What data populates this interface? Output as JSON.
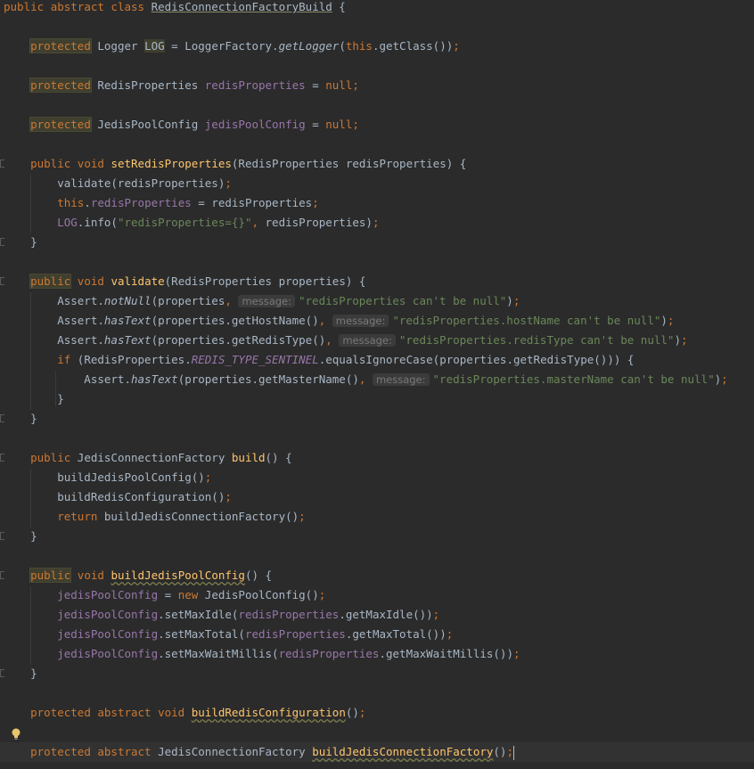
{
  "editor": {
    "language": "Java",
    "theme": "Darcula",
    "colors": {
      "background": "#2b2b2b",
      "keyword": "#cc7832",
      "field": "#9876aa",
      "method": "#ffc66d",
      "string": "#6a8759",
      "text": "#a9b7c6",
      "hint": "#787878"
    },
    "lines": [
      {
        "tokens": [
          [
            "kw",
            "public "
          ],
          [
            "kw",
            "abstract "
          ],
          [
            "kw",
            "class "
          ],
          [
            "cls-ul",
            "RedisConnectionFactoryBuild"
          ],
          [
            "plain",
            " {"
          ]
        ]
      },
      {
        "tokens": []
      },
      {
        "tokens": [
          [
            "plain",
            "    "
          ],
          [
            "kw-hl",
            "protected"
          ],
          [
            "plain",
            " Logger "
          ],
          [
            "field-hl",
            "LOG"
          ],
          [
            "plain",
            " = LoggerFactory."
          ],
          [
            "static-call",
            "getLogger"
          ],
          [
            "plain",
            "("
          ],
          [
            "kw",
            "this"
          ],
          [
            "plain",
            ".getClass())"
          ],
          [
            "semi",
            ";"
          ]
        ]
      },
      {
        "tokens": []
      },
      {
        "tokens": [
          [
            "plain",
            "    "
          ],
          [
            "kw-hl",
            "protected"
          ],
          [
            "plain",
            " RedisProperties "
          ],
          [
            "field",
            "redisProperties"
          ],
          [
            "plain",
            " = "
          ],
          [
            "kw",
            "null"
          ],
          [
            "semi",
            ";"
          ]
        ]
      },
      {
        "tokens": []
      },
      {
        "tokens": [
          [
            "plain",
            "    "
          ],
          [
            "kw-hl",
            "protected"
          ],
          [
            "plain",
            " JedisPoolConfig "
          ],
          [
            "field",
            "jedisPoolConfig"
          ],
          [
            "plain",
            " = "
          ],
          [
            "kw",
            "null"
          ],
          [
            "semi",
            ";"
          ]
        ]
      },
      {
        "tokens": []
      },
      {
        "tokens": [
          [
            "plain",
            "    "
          ],
          [
            "kw",
            "public "
          ],
          [
            "kw",
            "void "
          ],
          [
            "method",
            "setRedisProperties"
          ],
          [
            "plain",
            "(RedisProperties redisProperties) {"
          ]
        ],
        "fold": true
      },
      {
        "tokens": [
          [
            "plain",
            "        validate(redisProperties)"
          ],
          [
            "semi",
            ";"
          ]
        ]
      },
      {
        "tokens": [
          [
            "plain",
            "        "
          ],
          [
            "kw",
            "this"
          ],
          [
            "plain",
            "."
          ],
          [
            "field",
            "redisProperties"
          ],
          [
            "plain",
            " = redisProperties"
          ],
          [
            "semi",
            ";"
          ]
        ]
      },
      {
        "tokens": [
          [
            "plain",
            "        "
          ],
          [
            "field",
            "LOG"
          ],
          [
            "plain",
            ".info("
          ],
          [
            "string",
            "\"redisProperties={}\""
          ],
          [
            "semi",
            ","
          ],
          [
            "plain",
            " redisProperties)"
          ],
          [
            "semi",
            ";"
          ]
        ]
      },
      {
        "tokens": [
          [
            "plain",
            "    }"
          ]
        ],
        "fold": true
      },
      {
        "tokens": []
      },
      {
        "tokens": [
          [
            "plain",
            "    "
          ],
          [
            "kw-hl",
            "public"
          ],
          [
            "plain",
            " "
          ],
          [
            "kw",
            "void "
          ],
          [
            "method",
            "validate"
          ],
          [
            "plain",
            "(RedisProperties properties) {"
          ]
        ],
        "fold": true
      },
      {
        "tokens": [
          [
            "plain",
            "        Assert."
          ],
          [
            "static-call",
            "notNull"
          ],
          [
            "plain",
            "(properties"
          ],
          [
            "semi",
            ","
          ],
          [
            "plain",
            " "
          ],
          [
            "hint",
            "message:"
          ],
          [
            "string",
            "\"redisProperties can't be null\""
          ],
          [
            "plain",
            ")"
          ],
          [
            "semi",
            ";"
          ]
        ]
      },
      {
        "tokens": [
          [
            "plain",
            "        Assert."
          ],
          [
            "static-call",
            "hasText"
          ],
          [
            "plain",
            "(properties.getHostName()"
          ],
          [
            "semi",
            ","
          ],
          [
            "plain",
            " "
          ],
          [
            "hint",
            "message:"
          ],
          [
            "string",
            "\"redisProperties.hostName can't be null\""
          ],
          [
            "plain",
            ")"
          ],
          [
            "semi",
            ";"
          ]
        ]
      },
      {
        "tokens": [
          [
            "plain",
            "        Assert."
          ],
          [
            "static-call",
            "hasText"
          ],
          [
            "plain",
            "(properties.getRedisType()"
          ],
          [
            "semi",
            ","
          ],
          [
            "plain",
            " "
          ],
          [
            "hint",
            "message:"
          ],
          [
            "string",
            "\"redisProperties.redisType can't be null\""
          ],
          [
            "plain",
            ")"
          ],
          [
            "semi",
            ";"
          ]
        ]
      },
      {
        "tokens": [
          [
            "plain",
            "        "
          ],
          [
            "kw",
            "if "
          ],
          [
            "plain",
            "(RedisProperties."
          ],
          [
            "static-field",
            "REDIS_TYPE_SENTINEL"
          ],
          [
            "plain",
            ".equalsIgnoreCase(properties.getRedisType())) {"
          ]
        ]
      },
      {
        "tokens": [
          [
            "plain",
            "            Assert."
          ],
          [
            "static-call",
            "hasText"
          ],
          [
            "plain",
            "(properties.getMasterName()"
          ],
          [
            "semi",
            ","
          ],
          [
            "plain",
            " "
          ],
          [
            "hint",
            "message:"
          ],
          [
            "string",
            "\"redisProperties.masterName can't be null\""
          ],
          [
            "plain",
            ")"
          ],
          [
            "semi",
            ";"
          ]
        ]
      },
      {
        "tokens": [
          [
            "plain",
            "        }"
          ]
        ]
      },
      {
        "tokens": [
          [
            "plain",
            "    }"
          ]
        ],
        "fold": true
      },
      {
        "tokens": []
      },
      {
        "tokens": [
          [
            "plain",
            "    "
          ],
          [
            "kw",
            "public "
          ],
          [
            "plain",
            "JedisConnectionFactory "
          ],
          [
            "method",
            "build"
          ],
          [
            "plain",
            "() {"
          ]
        ],
        "fold": true
      },
      {
        "tokens": [
          [
            "plain",
            "        buildJedisPoolConfig()"
          ],
          [
            "semi",
            ";"
          ]
        ]
      },
      {
        "tokens": [
          [
            "plain",
            "        buildRedisConfiguration()"
          ],
          [
            "semi",
            ";"
          ]
        ]
      },
      {
        "tokens": [
          [
            "plain",
            "        "
          ],
          [
            "kw",
            "return "
          ],
          [
            "plain",
            "buildJedisConnectionFactory()"
          ],
          [
            "semi",
            ";"
          ]
        ]
      },
      {
        "tokens": [
          [
            "plain",
            "    }"
          ]
        ],
        "fold": true
      },
      {
        "tokens": []
      },
      {
        "tokens": [
          [
            "plain",
            "    "
          ],
          [
            "kw-hl",
            "public"
          ],
          [
            "plain",
            " "
          ],
          [
            "kw",
            "void "
          ],
          [
            "method-ul",
            "buildJedisPoolConfig"
          ],
          [
            "plain",
            "() {"
          ]
        ],
        "fold": true
      },
      {
        "tokens": [
          [
            "plain",
            "        "
          ],
          [
            "field",
            "jedisPoolConfig"
          ],
          [
            "plain",
            " = "
          ],
          [
            "kw",
            "new "
          ],
          [
            "plain",
            "JedisPoolConfig()"
          ],
          [
            "semi",
            ";"
          ]
        ]
      },
      {
        "tokens": [
          [
            "plain",
            "        "
          ],
          [
            "field",
            "jedisPoolConfig"
          ],
          [
            "plain",
            ".setMaxIdle("
          ],
          [
            "field",
            "redisProperties"
          ],
          [
            "plain",
            ".getMaxIdle())"
          ],
          [
            "semi",
            ";"
          ]
        ]
      },
      {
        "tokens": [
          [
            "plain",
            "        "
          ],
          [
            "field",
            "jedisPoolConfig"
          ],
          [
            "plain",
            ".setMaxTotal("
          ],
          [
            "field",
            "redisProperties"
          ],
          [
            "plain",
            ".getMaxTotal())"
          ],
          [
            "semi",
            ";"
          ]
        ]
      },
      {
        "tokens": [
          [
            "plain",
            "        "
          ],
          [
            "field",
            "jedisPoolConfig"
          ],
          [
            "plain",
            ".setMaxWaitMillis("
          ],
          [
            "field",
            "redisProperties"
          ],
          [
            "plain",
            ".getMaxWaitMillis())"
          ],
          [
            "semi",
            ";"
          ]
        ]
      },
      {
        "tokens": [
          [
            "plain",
            "    }"
          ]
        ],
        "fold": true
      },
      {
        "tokens": []
      },
      {
        "tokens": [
          [
            "plain",
            "    "
          ],
          [
            "kw",
            "protected "
          ],
          [
            "kw",
            "abstract "
          ],
          [
            "kw",
            "void "
          ],
          [
            "method-ul",
            "buildRedisConfiguration"
          ],
          [
            "plain",
            "()"
          ],
          [
            "semi",
            ";"
          ]
        ]
      },
      {
        "tokens": []
      },
      {
        "tokens": [
          [
            "plain",
            "    "
          ],
          [
            "kw",
            "protected "
          ],
          [
            "kw",
            "abstract "
          ],
          [
            "plain",
            "JedisConnectionFactory "
          ],
          [
            "method-ul",
            "buildJedisConnectionFactory"
          ],
          [
            "plain",
            "()"
          ],
          [
            "semi",
            ";"
          ]
        ],
        "current": true,
        "caret": true
      }
    ]
  }
}
